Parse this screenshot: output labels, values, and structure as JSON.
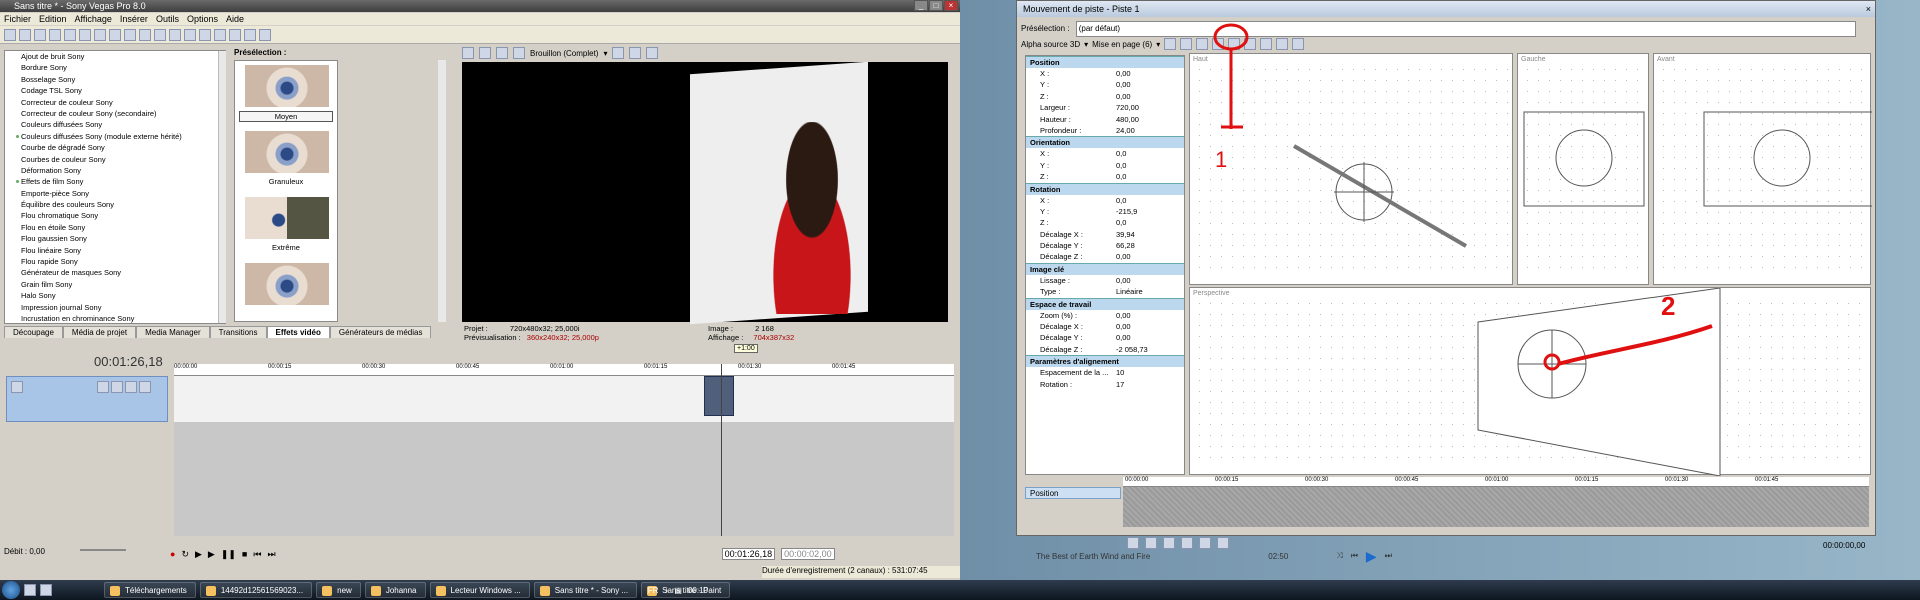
{
  "vegas": {
    "title": "Sans titre * - Sony Vegas Pro 8.0",
    "menu": [
      "Fichier",
      "Edition",
      "Affichage",
      "Insérer",
      "Outils",
      "Options",
      "Aide"
    ],
    "effects": [
      "Ajout de bruit Sony",
      "Bordure Sony",
      "Bosselage Sony",
      "Codage TSL Sony",
      "Correcteur de couleur Sony",
      "Correcteur de couleur Sony (secondaire)",
      "Couleurs diffusées Sony",
      "Couleurs diffusées Sony (module externe hérité)",
      "Courbe de dégradé Sony",
      "Courbes de couleur Sony",
      "Déformation Sony",
      "Effets de film Sony",
      "Emporte-pièce Sony",
      "Équilibre des couleurs Sony",
      "Flou chromatique Sony",
      "Flou en étoile Sony",
      "Flou gaussien Sony",
      "Flou linéaire Sony",
      "Flou rapide Sony",
      "Générateur de masques Sony",
      "Grain film Sony",
      "Halo Sony",
      "Impression journal Sony",
      "Incrustation en chrominance Sony"
    ],
    "preset_label": "Présélection :",
    "presets": [
      "Moyen",
      "Granuleux",
      "Extrême"
    ],
    "preview_mode": "Brouillon (Complet)",
    "project_label": "Projet :",
    "project_value": "720x480x32; 25,000i",
    "preview_label": "Prévisualisation :",
    "preview_value": "360x240x32; 25,000p",
    "image_label": "Image :",
    "image_value": "2 168",
    "display_label": "Affichage :",
    "display_value": "704x387x32",
    "tabs": [
      "Découpage",
      "Média de projet",
      "Media Manager",
      "Transitions",
      "Effets vidéo",
      "Générateurs de médias"
    ],
    "active_tab": "Effets vidéo",
    "timecode": "00:01:26,18",
    "ruler": [
      "00:00:00",
      "00:00:15",
      "00:00:30",
      "00:00:45",
      "00:01:00",
      "00:01:15",
      "00:01:30",
      "00:01:45"
    ],
    "end_marker": "+1:00",
    "debit": "Débit : 0,00",
    "time_a": "00:01:26,18",
    "time_b": "00:00:02,00",
    "status": "Durée d'enregistrement (2 canaux) : 531:07:45"
  },
  "taskbar": {
    "items": [
      "Téléchargements",
      "14492d12561569023...",
      "new",
      "Johanna",
      "Lecteur Windows ...",
      "Sans titre * - Sony ...",
      "Sans titre - Paint"
    ],
    "lang": "FR",
    "clock": "00:10"
  },
  "track_motion": {
    "title": "Mouvement de piste - Piste 1",
    "preset_label": "Présélection :",
    "preset_value": "(par défaut)",
    "alpha_source": "Alpha source 3D",
    "layout": "Mise en page (6)",
    "views": [
      "Haut",
      "Gauche",
      "Avant",
      "Perspective"
    ],
    "sections": [
      {
        "name": "Position",
        "rows": [
          [
            "X :",
            "0,00"
          ],
          [
            "Y :",
            "0,00"
          ],
          [
            "Z :",
            "0,00"
          ],
          [
            "Largeur :",
            "720,00"
          ],
          [
            "Hauteur :",
            "480,00"
          ],
          [
            "Profondeur :",
            "24,00"
          ]
        ]
      },
      {
        "name": "Orientation",
        "rows": [
          [
            "X :",
            "0,0"
          ],
          [
            "Y :",
            "0,0"
          ],
          [
            "Z :",
            "0,0"
          ]
        ]
      },
      {
        "name": "Rotation",
        "rows": [
          [
            "X :",
            "0,0"
          ],
          [
            "Y :",
            "-215,9"
          ],
          [
            "Z :",
            "0,0"
          ],
          [
            "Décalage X :",
            "39,94"
          ],
          [
            "Décalage Y :",
            "66,28"
          ],
          [
            "Décalage Z :",
            "0,00"
          ]
        ]
      },
      {
        "name": "Image clé",
        "rows": [
          [
            "Lissage :",
            "0,00"
          ],
          [
            "Type :",
            "Linéaire"
          ]
        ]
      },
      {
        "name": "Espace de travail",
        "rows": [
          [
            "Zoom (%) :",
            "0,00"
          ],
          [
            "Décalage X :",
            "0,00"
          ],
          [
            "Décalage Y :",
            "0,00"
          ],
          [
            "Décalage Z :",
            "-2 058,73"
          ]
        ]
      },
      {
        "name": "Paramètres d'alignement",
        "rows": [
          [
            "Espacement de la ...",
            "10"
          ],
          [
            "Rotation :",
            "17"
          ]
        ]
      }
    ],
    "track_label": "Position",
    "ruler": [
      "00:00:00",
      "00:00:15",
      "00:00:30",
      "00:00:45",
      "00:01:00",
      "00:01:15",
      "00:01:30",
      "00:01:45"
    ],
    "timecode": "00:00:00,00",
    "annotations": [
      "1",
      "2"
    ]
  },
  "media_player": {
    "track": "The Best of Earth Wind and Fire",
    "time": "02:50"
  },
  "colors": {
    "annotation": "#e01010",
    "section_bg": "#bcd8ee",
    "track_header": "#a8c4e6"
  }
}
